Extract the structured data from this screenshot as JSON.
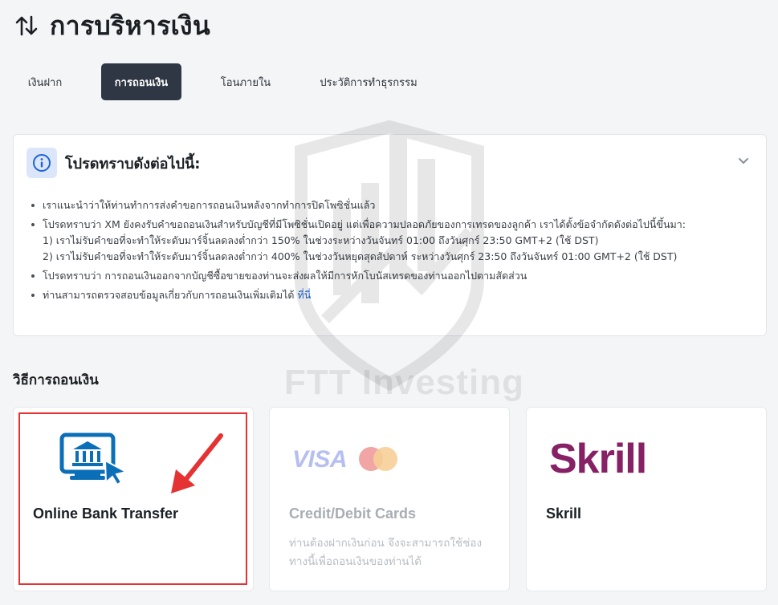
{
  "header": {
    "title": "การบริหารเงิน",
    "icon": "up-down-arrows-icon"
  },
  "tabs": [
    {
      "label": "เงินฝาก",
      "active": false
    },
    {
      "label": "การถอนเงิน",
      "active": true
    },
    {
      "label": "โอนภายใน",
      "active": false
    },
    {
      "label": "ประวัติการทำธุรกรรม",
      "active": false
    }
  ],
  "notice": {
    "title": "โปรดทราบดังต่อไปนี้:",
    "icon": "info-icon",
    "items": [
      "เราแนะนำว่าให้ท่านทำการส่งคำขอการถอนเงินหลังจากทำการปิดโพซิชั่นแล้ว",
      "โปรดทราบว่า XM ยังคงรับคำขอถอนเงินสำหรับบัญชีที่มีโพซิชั่นเปิดอยู่ แต่เพื่อความปลอดภัยของการเทรดของลูกค้า เราได้ตั้งข้อจำกัดดังต่อไปนี้ขึ้นมา:",
      "โปรดทราบว่า การถอนเงินออกจากบัญชีซื้อขายของท่านจะส่งผลให้มีการหักโบนัสเทรดของท่านออกไปตามสัดส่วน",
      "ท่านสามารถตรวจสอบข้อมูลเกี่ยวกับการถอนเงินเพิ่มเติมได้"
    ],
    "sub_items": [
      "1) เราไม่รับคำขอที่จะทำให้ระดับมาร์จิ้นลดลงต่ำกว่า 150% ในช่วงระหว่างวันจันทร์ 01:00 ถึงวันศุกร์ 23:50 GMT+2 (ใช้ DST)",
      "2) เราไม่รับคำขอที่จะทำให้ระดับมาร์จิ้นลดลงต่ำกว่า 400% ในช่วงวันหยุดสุดสัปดาห์ ระหว่างวันศุกร์ 23:50 ถึงวันจันทร์ 01:00 GMT+2 (ใช้ DST)"
    ],
    "link_text": "ที่นี่"
  },
  "watermark": "FTT Investing",
  "section_title": "วิธีการถอนเงิน",
  "methods": [
    {
      "label": "Online Bank Transfer",
      "icon": "online-bank-icon",
      "highlighted": true
    },
    {
      "label": "Credit/Debit Cards",
      "logo": "VISA",
      "icon": "mastercard-icon",
      "disabled": true,
      "description": "ท่านต้องฝากเงินก่อน จึงจะสามารถใช้ช่องทางนี้เพื่อถอนเงินของท่านได้"
    },
    {
      "label": "Skrill",
      "logo": "Skrill"
    }
  ],
  "colors": {
    "active_tab": "#2f3744",
    "link": "#1e63d6",
    "highlight": "#e53232",
    "skrill": "#862165",
    "bank_icon": "#0b6fb8"
  }
}
